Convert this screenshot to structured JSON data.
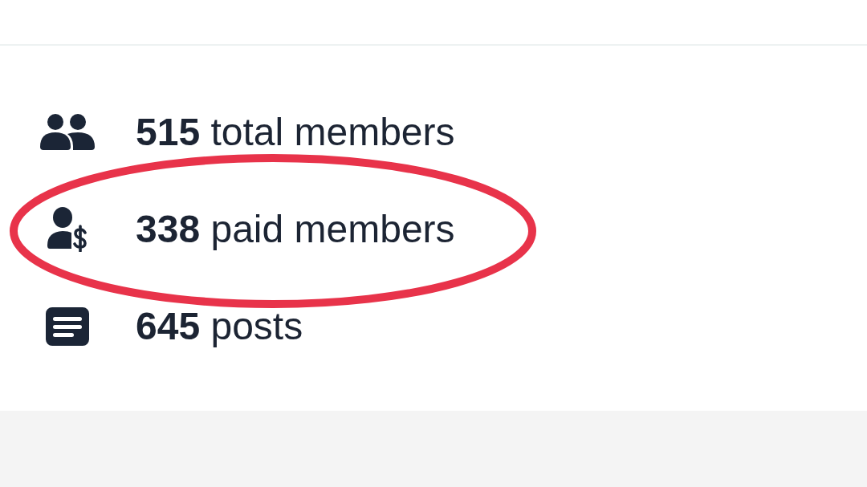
{
  "stats": [
    {
      "kind": "members",
      "text": "**515** total members",
      "highlighted": false
    },
    {
      "kind": "paid_members",
      "text": "**338** paid members",
      "highlighted": true
    },
    {
      "kind": "posts",
      "text": "**645** posts",
      "highlighted": false
    }
  ]
}
